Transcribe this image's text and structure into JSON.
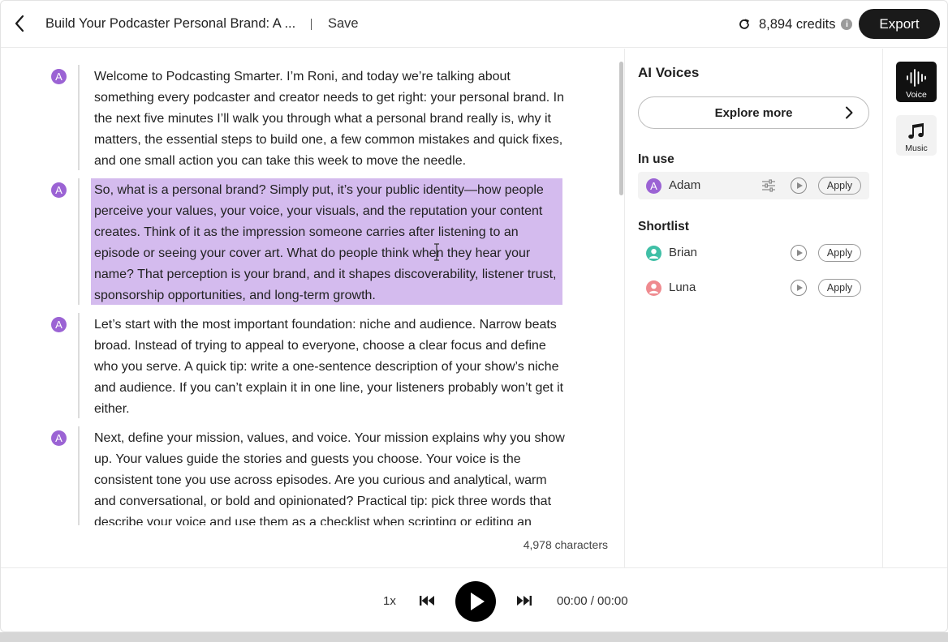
{
  "header": {
    "title": "Build Your Podcaster Personal Brand: A ...",
    "save_label": "Save",
    "credits": "8,894 credits",
    "info_glyph": "i",
    "export_label": "Export",
    "icons": {
      "back": "chevron-left-icon",
      "refresh": "refresh-icon",
      "info": "info-icon"
    }
  },
  "editor": {
    "paragraphs": [
      {
        "speaker": "A",
        "text": "Welcome to Podcasting Smarter. I’m Roni, and today we’re talking about something every podcaster and creator needs to get right: your personal brand. In the next five minutes I’ll walk you through what a personal brand really is, why it matters, the essential steps to build one, a few common mistakes and quick fixes, and one small action you can take this week to move the needle."
      },
      {
        "speaker": "A",
        "text": "So, what is a personal brand? Simply put, it’s your public identity—how people perceive your values, your voice, your visuals, and the reputation your content creates. Think of it as the impression someone carries after listening to an episode or seeing your cover art. What do people think when they hear your name? That perception is your brand, and it shapes discoverability, listener trust, sponsorship opportunities, and long-term growth.",
        "selected": true
      },
      {
        "speaker": "A",
        "text": "Let’s start with the most important foundation: niche and audience. Narrow beats broad. Instead of trying to appeal to everyone, choose a clear focus and define who you serve. A quick tip: write a one-sentence description of your show’s niche and audience. If you can’t explain it in one line, your listeners probably won’t get it either."
      },
      {
        "speaker": "A",
        "text": "Next, define your mission, values, and voice. Your mission explains why you show up. Your values guide the stories and guests you choose. Your voice is the consistent tone you use across episodes. Are you curious and analytical, warm and conversational, or bold and opinionated? Practical tip: pick three words that describe your voice and use them as a checklist when scripting or editing an episode."
      }
    ],
    "char_count": "4,978 characters",
    "speaker_color": "#9b63d4",
    "highlight_color": "#d4bbee"
  },
  "voices": {
    "title": "AI Voices",
    "explore_label": "Explore more",
    "in_use_label": "In use",
    "in_use": {
      "initial": "A",
      "name": "Adam",
      "apply_label": "Apply",
      "icons": [
        "sliders-icon",
        "play-icon"
      ]
    },
    "shortlist_label": "Shortlist",
    "shortlist": [
      {
        "name": "Brian",
        "avatar_color": "#3fbfa6",
        "apply_label": "Apply",
        "avatar_icon": "person-icon"
      },
      {
        "name": "Luna",
        "avatar_color": "#ef8a8f",
        "apply_label": "Apply",
        "avatar_icon": "person-icon"
      }
    ]
  },
  "rail": {
    "items": [
      {
        "label": "Voice",
        "icon": "waveform-icon",
        "active": true
      },
      {
        "label": "Music",
        "icon": "music-note-icon",
        "active": false
      }
    ]
  },
  "player": {
    "speed": "1x",
    "time": "00:00 / 00:00",
    "icons": [
      "skip-back-icon",
      "play-icon",
      "skip-forward-icon"
    ]
  }
}
